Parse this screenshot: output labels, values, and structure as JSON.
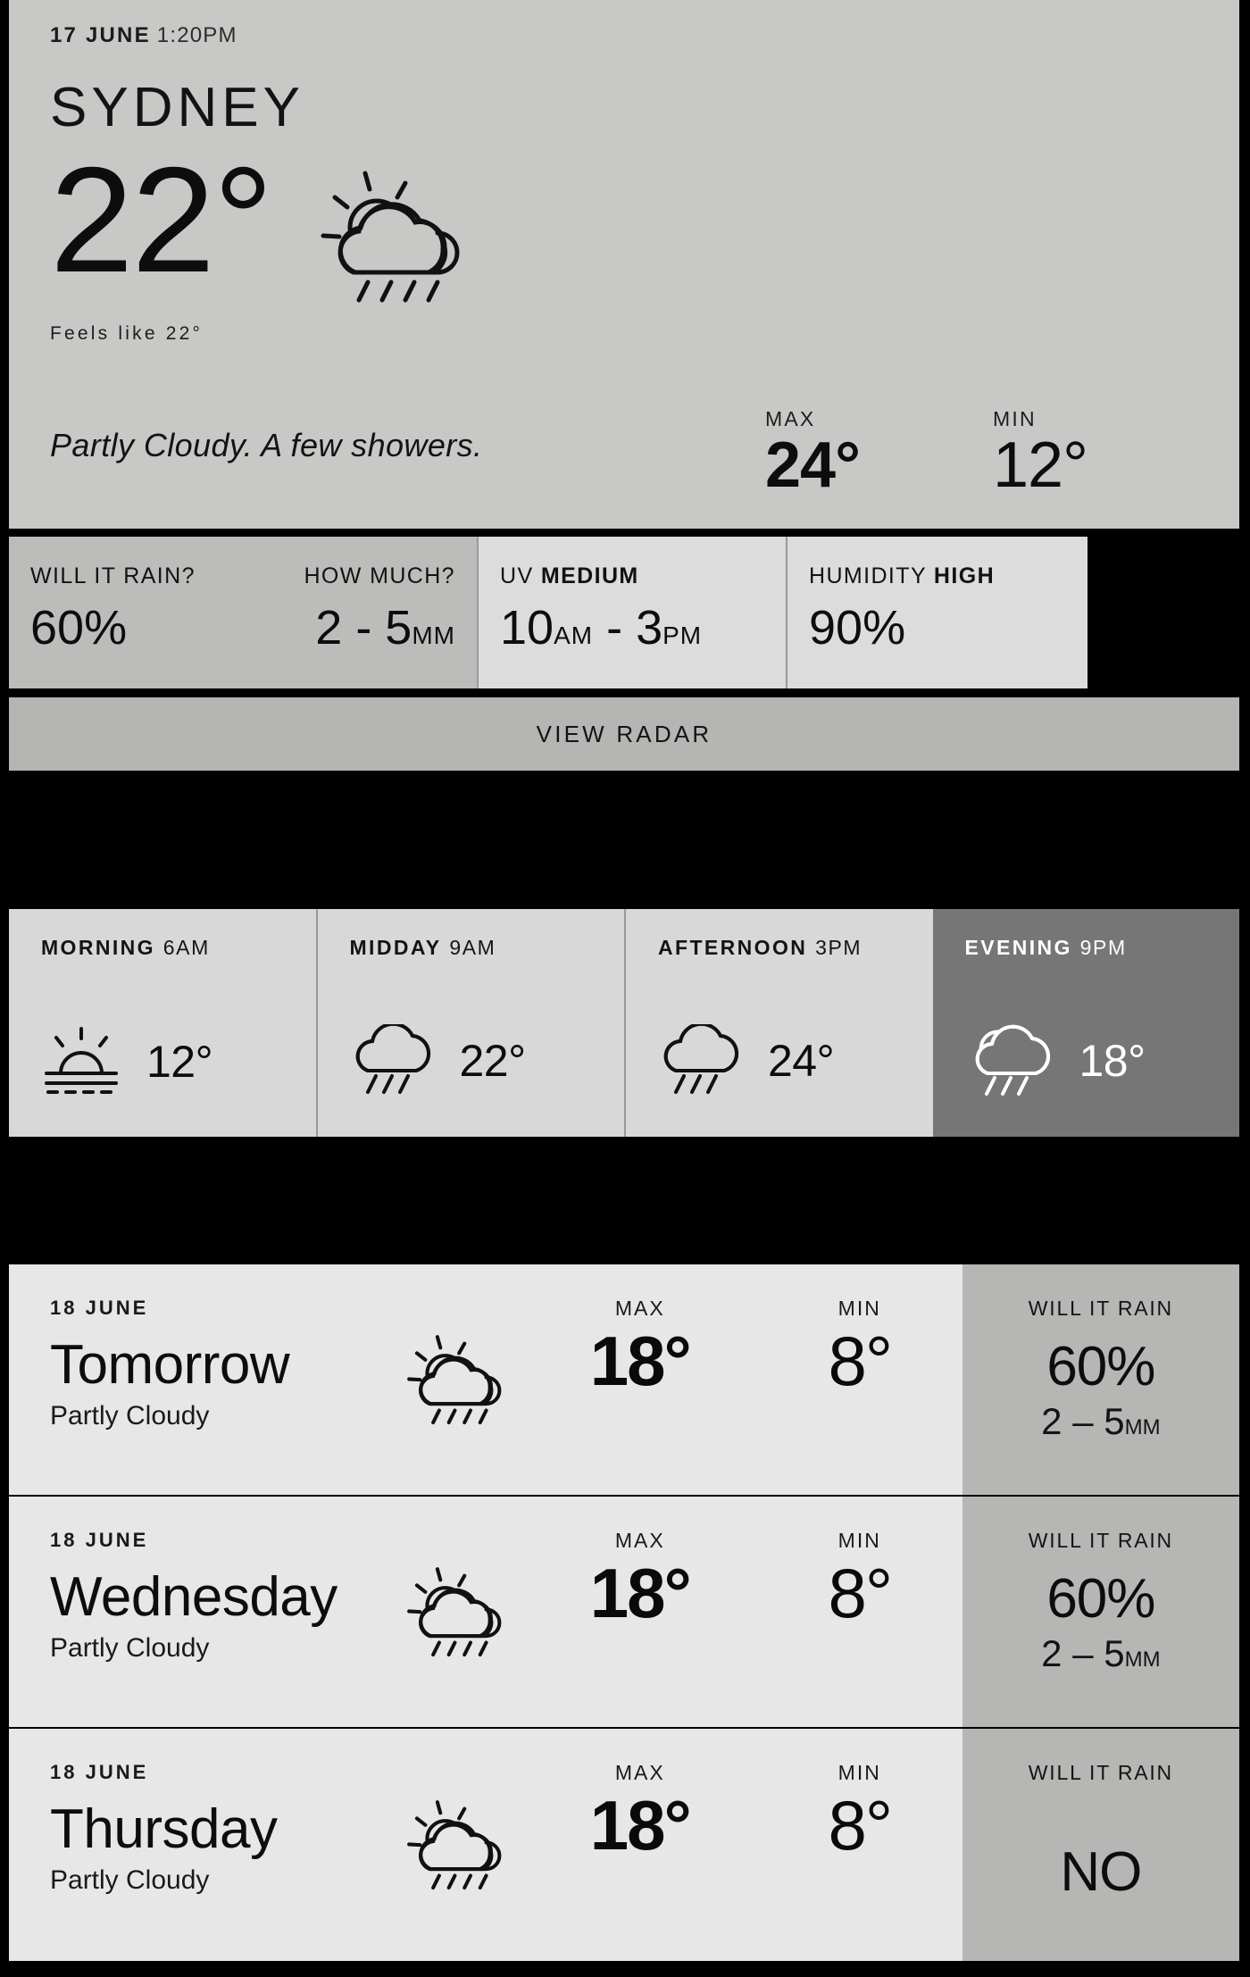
{
  "current": {
    "date": "17 JUNE",
    "time": "1:20PM",
    "city": "SYDNEY",
    "temperature": "22°",
    "icon": "sun-cloud-rain-icon",
    "feels_like": "Feels like 22°",
    "description": "Partly Cloudy. A few showers.",
    "max_label": "MAX",
    "max_value": "24°",
    "min_label": "MIN",
    "min_value": "12°"
  },
  "stats": [
    {
      "label_plain": "WILL IT RAIN?",
      "label_bold": "",
      "value": "60%",
      "unit": "",
      "tone": "dark"
    },
    {
      "label_plain": "HOW MUCH?",
      "label_bold": "",
      "value": "2 - 5",
      "unit": "MM",
      "tone": "dark"
    },
    {
      "label_plain": "UV ",
      "label_bold": "MEDIUM",
      "value": "10",
      "unit": "AM - 3PM",
      "tone": "light"
    },
    {
      "label_plain": "HUMIDITY ",
      "label_bold": "HIGH",
      "value": "90%",
      "unit": "",
      "tone": "light"
    }
  ],
  "uv_value_parts": {
    "num1": "10",
    "u1": "AM",
    "dash": " - ",
    "num2": "3",
    "u2": "PM"
  },
  "radar": {
    "label": "VIEW RADAR"
  },
  "hourly": [
    {
      "period": "MORNING",
      "time": "6AM",
      "icon": "sunrise-icon",
      "temp": "12°",
      "tone": "light"
    },
    {
      "period": "MIDDAY",
      "time": "9AM",
      "icon": "cloud-rain-icon",
      "temp": "22°",
      "tone": "light"
    },
    {
      "period": "AFTERNOON",
      "time": "3PM",
      "icon": "cloud-rain-icon",
      "temp": "24°",
      "tone": "light"
    },
    {
      "period": "EVENING",
      "time": "9PM",
      "icon": "moon-cloud-rain-icon",
      "temp": "18°",
      "tone": "dark"
    }
  ],
  "daily": [
    {
      "date": "18 JUNE",
      "day": "Tomorrow",
      "condition": "Partly Cloudy",
      "icon": "sun-cloud-rain-icon",
      "max_label": "MAX",
      "max_value": "18°",
      "min_label": "MIN",
      "min_value": "8°",
      "rain_label": "WILL IT RAIN",
      "rain_value": "60%",
      "rain_amount": "2 – 5",
      "rain_amount_unit": "MM"
    },
    {
      "date": "18 JUNE",
      "day": "Wednesday",
      "condition": "Partly Cloudy",
      "icon": "sun-cloud-rain-icon",
      "max_label": "MAX",
      "max_value": "18°",
      "min_label": "MIN",
      "min_value": "8°",
      "rain_label": "WILL IT RAIN",
      "rain_value": "60%",
      "rain_amount": "2 – 5",
      "rain_amount_unit": "MM"
    },
    {
      "date": "18 JUNE",
      "day": "Thursday",
      "condition": "Partly Cloudy",
      "icon": "sun-cloud-rain-icon",
      "max_label": "MAX",
      "max_value": "18°",
      "min_label": "MIN",
      "min_value": "8°",
      "rain_label": "WILL IT RAIN",
      "rain_value": "NO",
      "rain_amount": "",
      "rain_amount_unit": ""
    }
  ],
  "colors": {
    "background": "#000000",
    "panel_main": "#c8c8c6",
    "panel_dark_stat": "#bcbcba",
    "panel_light_stat": "#dcdcdc",
    "radar_bar": "#b5b5b3",
    "hour_light": "#d8d8d8",
    "hour_dark": "#767676",
    "daily_row": "#e7e7e7",
    "daily_rain": "#b6b6b4"
  }
}
